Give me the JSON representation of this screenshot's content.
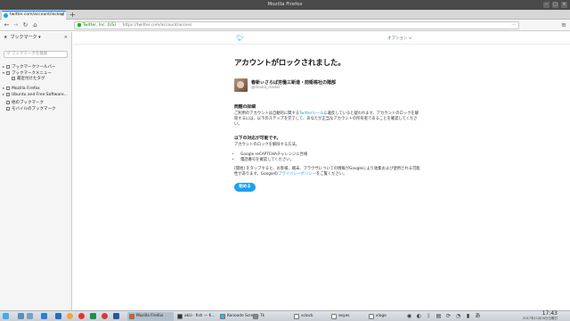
{
  "window": {
    "title": "Mozilla Firefox"
  },
  "tabs": [
    {
      "label": "twitter.com/account/locked"
    }
  ],
  "nav": {
    "org_name": "Twitter, Inc. (US)",
    "url": "https://twitter.com/account/access"
  },
  "sidebar": {
    "title": "ブックマーク",
    "search_placeholder": "ブックマークを検索",
    "items": [
      {
        "label": "ブックマークツールバー",
        "indent": 0,
        "type": "folder",
        "twisty": "▸"
      },
      {
        "label": "ブックマークメニュー",
        "indent": 0,
        "type": "folder",
        "twisty": "▾"
      },
      {
        "label": "最近付けたタグ",
        "indent": 1,
        "type": "folder",
        "twisty": ""
      },
      {
        "label": "Mozilla Firefox",
        "indent": 0,
        "type": "folder",
        "twisty": "▸"
      },
      {
        "label": "Ubuntu and Free Software...",
        "indent": 0,
        "type": "folder",
        "twisty": "▸"
      },
      {
        "label": "他のブックマーク",
        "indent": 0,
        "type": "folder",
        "twisty": ""
      },
      {
        "label": "モバイルのブックマーク",
        "indent": 0,
        "type": "folder",
        "twisty": ""
      }
    ]
  },
  "page": {
    "options_label": "オプション ∨",
    "heading": "アカウントがロックされました。",
    "account": {
      "name": "春新ぃさらば労働三新道・前衛株社の階部",
      "handle": "@itsuka_rosaki"
    },
    "section1_title": "問題の詳細",
    "section1_text_a": "ご利用のアカウントは自動的に関する",
    "section1_link": "Twitterルール",
    "section1_text_b": "に違反していると疑われます。アカウントのロックを解除するには、以下のステップを完了して、あなたが正当なアカウントの所有者であることを確認してください。",
    "section2_title": "以下の対応が可能です。",
    "section2_text": "アカウントのロックを解除する方法。",
    "steps": [
      "Google reCAPTCHAチャレンジに合格",
      "電話番号を確認してください。"
    ],
    "notice_a": "[開始] をタップすると、お客様、端末、ブラウザについての情報がGoogleにより收集および使用される可能性があります。Googleの",
    "notice_link": "プライバシーポリシー",
    "notice_b": "をご覧ください。",
    "start_button": "始める"
  },
  "taskbar": {
    "tasks": [
      {
        "label": "Mozilla Firefox",
        "color": "#e66000",
        "active": true
      },
      {
        "label": "akiii · fish — K...",
        "color": "#333333",
        "active": false
      },
      {
        "label": "Kenoode Scree...",
        "color": "#3daee9",
        "active": false
      },
      {
        "label": "Tk",
        "color": "#888888",
        "active": false
      },
      {
        "label": "xclock",
        "color": "#ffffff",
        "active": false
      },
      {
        "label": "xeyes",
        "color": "#ffffff",
        "active": false
      },
      {
        "label": "xlogo",
        "color": "#ffffff",
        "active": false
      }
    ],
    "time": "17:43",
    "date": "2017年11月26日日曜日"
  },
  "colors": {
    "accent": "#1da1f2",
    "secure": "#058b00"
  }
}
